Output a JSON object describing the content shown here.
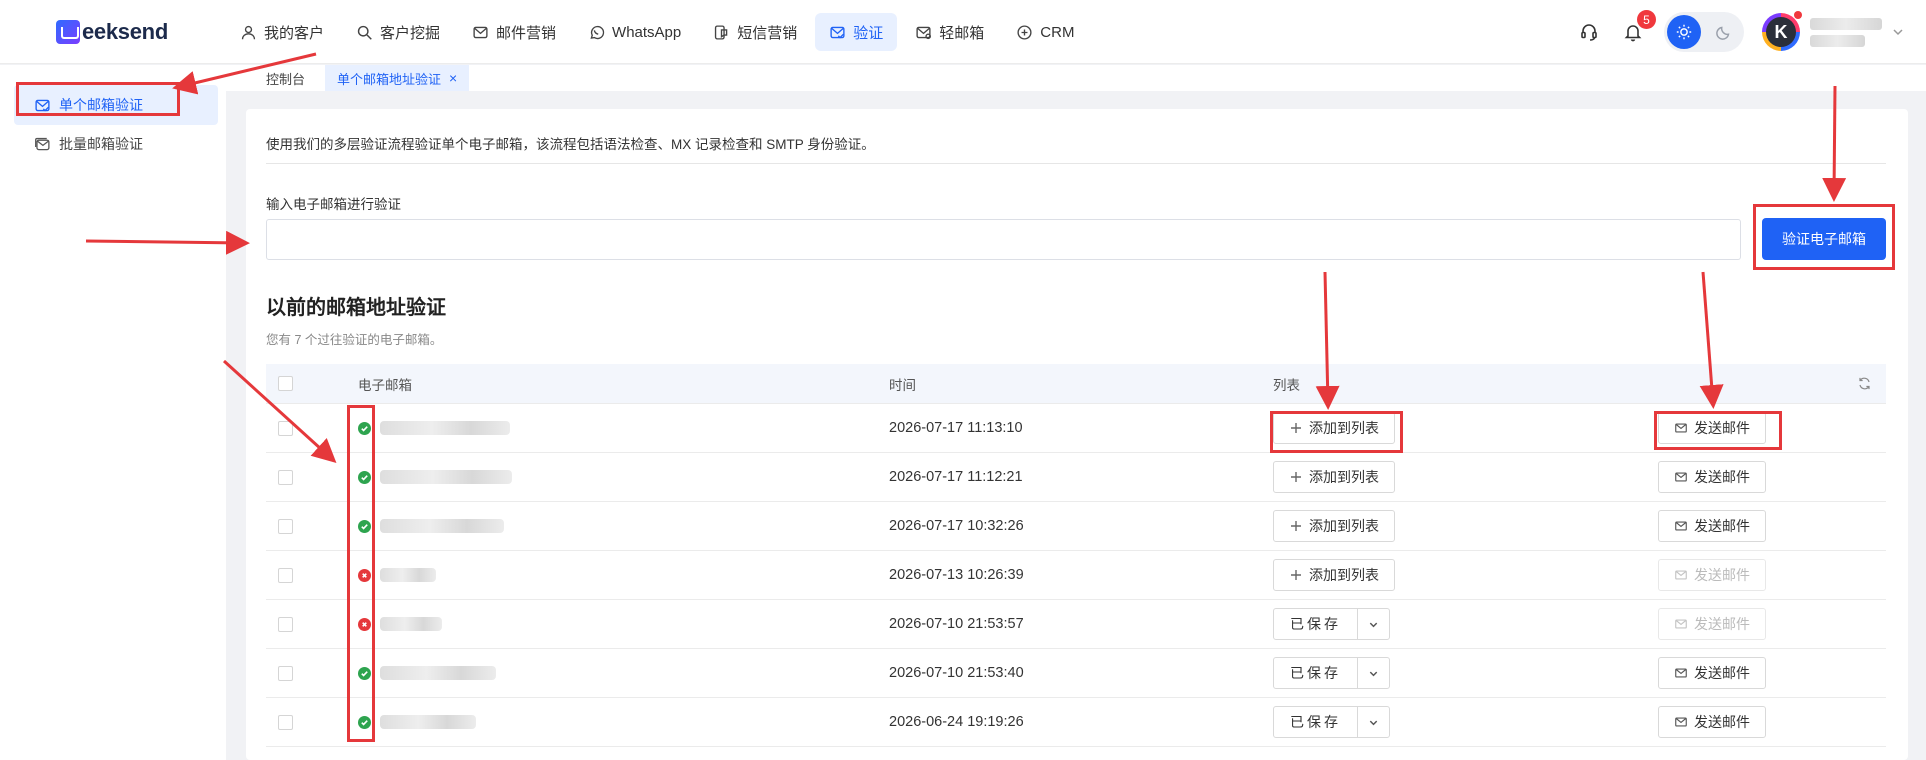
{
  "app": {
    "logo_text": "eeksend"
  },
  "nav": {
    "items": [
      {
        "label": "我的客户",
        "icon": "user-icon"
      },
      {
        "label": "客户挖掘",
        "icon": "search-icon"
      },
      {
        "label": "邮件营销",
        "icon": "mail-icon"
      },
      {
        "label": "WhatsApp",
        "icon": "whatsapp-icon"
      },
      {
        "label": "短信营销",
        "icon": "sms-icon"
      },
      {
        "label": "验证",
        "icon": "mail-check-icon",
        "active": true
      },
      {
        "label": "轻邮箱",
        "icon": "light-mail-icon"
      },
      {
        "label": "CRM",
        "icon": "crm-icon"
      }
    ]
  },
  "header": {
    "notification_count": "5",
    "theme": "light",
    "avatar_initial": "K"
  },
  "sidebar": {
    "items": [
      {
        "label": "单个邮箱验证",
        "active": true
      },
      {
        "label": "批量邮箱验证",
        "active": false
      }
    ]
  },
  "tabs": [
    {
      "label": "控制台"
    },
    {
      "label": "单个邮箱地址验证",
      "close": "×",
      "active": true
    }
  ],
  "main": {
    "intro": "使用我们的多层验证流程验证单个电子邮箱，该流程包括语法检查、MX 记录检查和 SMTP 身份验证。",
    "input_label": "输入电子邮箱进行验证",
    "input_value": "",
    "verify_button": "验证电子邮箱",
    "history_title": "以前的邮箱地址验证",
    "history_subtitle": "您有 7 个过往验证的电子邮箱。"
  },
  "table": {
    "columns": {
      "email": "电子邮箱",
      "time": "时间",
      "list": "列表"
    },
    "add_to_list_label": "添加到列表",
    "saved_label": "已保存",
    "send_email_label": "发送邮件",
    "rows": [
      {
        "status": "valid",
        "email_blur": 130,
        "time": "2026-07-17 11:13:10",
        "list_state": "add",
        "send_enabled": true
      },
      {
        "status": "valid",
        "email_blur": 132,
        "time": "2026-07-17 11:12:21",
        "list_state": "add",
        "send_enabled": true
      },
      {
        "status": "valid",
        "email_blur": 124,
        "time": "2026-07-17 10:32:26",
        "list_state": "add",
        "send_enabled": true
      },
      {
        "status": "invalid",
        "email_blur": 56,
        "time": "2026-07-13 10:26:39",
        "list_state": "add",
        "send_enabled": false
      },
      {
        "status": "invalid",
        "email_blur": 62,
        "time": "2026-07-10 21:53:57",
        "list_state": "saved",
        "send_enabled": false
      },
      {
        "status": "valid",
        "email_blur": 116,
        "time": "2026-07-10 21:53:40",
        "list_state": "saved",
        "send_enabled": true
      },
      {
        "status": "valid",
        "email_blur": 96,
        "time": "2026-06-24 19:19:26",
        "list_state": "saved",
        "send_enabled": true
      }
    ]
  },
  "annotation_color": "#e5383b"
}
